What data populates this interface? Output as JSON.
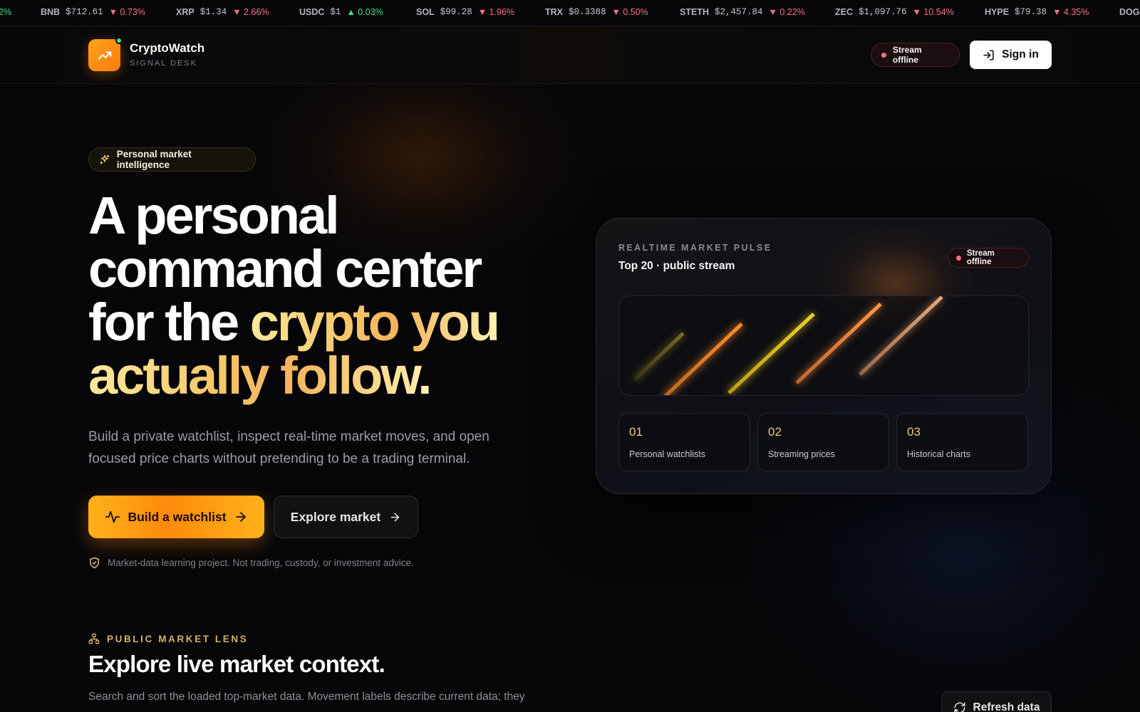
{
  "ticker": [
    {
      "symbol": "",
      "price": "",
      "change": "2%",
      "dir": "up"
    },
    {
      "symbol": "BNB",
      "price": "$712.61",
      "change": "▼ 0.73%",
      "dir": "down"
    },
    {
      "symbol": "XRP",
      "price": "$1.34",
      "change": "▼ 2.66%",
      "dir": "down"
    },
    {
      "symbol": "USDC",
      "price": "$1",
      "change": "▲ 0.03%",
      "dir": "up"
    },
    {
      "symbol": "SOL",
      "price": "$99.28",
      "change": "▼ 1.96%",
      "dir": "down"
    },
    {
      "symbol": "TRX",
      "price": "$0.3388",
      "change": "▼ 0.50%",
      "dir": "down"
    },
    {
      "symbol": "STETH",
      "price": "$2,457.84",
      "change": "▼ 0.22%",
      "dir": "down"
    },
    {
      "symbol": "ZEC",
      "price": "$1,097.76",
      "change": "▼ 10.54%",
      "dir": "down"
    },
    {
      "symbol": "HYPE",
      "price": "$79.38",
      "change": "▼ 4.35%",
      "dir": "down"
    },
    {
      "symbol": "DOG",
      "price": "",
      "change": "",
      "dir": "down"
    }
  ],
  "header": {
    "brand_name": "CryptoWatch",
    "brand_sub": "SIGNAL DESK",
    "stream_status": "Stream offline",
    "signin_label": "Sign in"
  },
  "hero": {
    "badge": "Personal market intelligence",
    "title_line1": "A personal",
    "title_line2": "command center",
    "title_line3_plain": "for the ",
    "title_line3_accent": "crypto you",
    "title_line4_accent": "actually follow.",
    "subtitle": "Build a private watchlist, inspect real-time market moves, and open focused price charts without pretending to be a trading terminal.",
    "primary_cta": "Build a watchlist",
    "secondary_cta": "Explore market",
    "disclaimer": "Market-data learning project. Not trading, custody, or investment advice."
  },
  "pulse": {
    "eyebrow": "REALTIME MARKET PULSE",
    "title": "Top 20 · public stream",
    "stream_status": "Stream offline",
    "features": [
      {
        "num": "01",
        "label": "Personal watchlists"
      },
      {
        "num": "02",
        "label": "Streaming prices"
      },
      {
        "num": "03",
        "label": "Historical charts"
      }
    ]
  },
  "lens": {
    "eyebrow": "PUBLIC MARKET LENS",
    "title": "Explore live market context.",
    "description": "Search and sort the loaded top-market data. Movement labels describe current data; they",
    "refresh_label": "Refresh data"
  },
  "colors": {
    "accent": "#ff9a12",
    "gold": "#e9c97a",
    "down": "#f87185",
    "up": "#4ade80",
    "background": "#060608"
  },
  "icons": {
    "logo": "trending-up-icon",
    "signin": "log-in-icon",
    "badge": "sparkles-icon",
    "primary_cta": "activity-icon",
    "arrow": "arrow-right-icon",
    "disclaimer": "shield-check-icon",
    "lens": "network-icon",
    "refresh": "refresh-icon"
  }
}
